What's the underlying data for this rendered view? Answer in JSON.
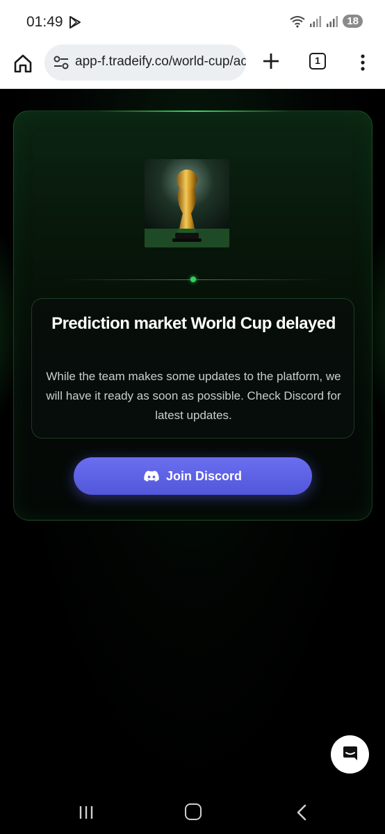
{
  "status_bar": {
    "time": "01:49",
    "battery": "18"
  },
  "browser": {
    "url": "app-f.tradeify.co/world-cup/ac",
    "tab_count": "1"
  },
  "card": {
    "title": "Prediction market World Cup delayed",
    "description": "While the team makes some updates to the platform, we will have it ready as soon as possible. Check Discord for latest updates.",
    "join_button_label": "Join Discord"
  },
  "colors": {
    "accent_green": "#33d15a",
    "discord_blue": "#5865f2"
  },
  "icons": [
    "play-store-icon",
    "wifi-icon",
    "signal-icon",
    "home-icon",
    "tune-icon",
    "plus-icon",
    "tabs-icon",
    "more-vert-icon",
    "discord-icon",
    "chat-icon",
    "recents-icon",
    "nav-home-icon",
    "back-icon"
  ]
}
